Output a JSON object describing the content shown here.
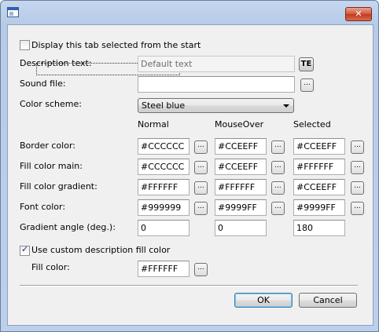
{
  "window": {
    "title": "",
    "close_label": "✕"
  },
  "display_tab_selected": {
    "label": "Display this tab selected from the start",
    "checked": false
  },
  "description": {
    "label": "Description text:",
    "placeholder": "Default text",
    "te_label": "TE"
  },
  "sound_file": {
    "label": "Sound file:",
    "value": "",
    "browse_label": "..."
  },
  "color_scheme": {
    "label": "Color scheme:",
    "selected": "Steel blue"
  },
  "columns": [
    "Normal",
    "MouseOver",
    "Selected"
  ],
  "browse_label": "...",
  "color_rows": [
    {
      "label": "Border color:",
      "values": [
        "#CCCCCC",
        "#CCEEFF",
        "#CCEEFF"
      ]
    },
    {
      "label": "Fill color main:",
      "values": [
        "#CCCCCC",
        "#CCEEFF",
        "#FFFFFF"
      ]
    },
    {
      "label": "Fill color gradient:",
      "values": [
        "#FFFFFF",
        "#FFFFFF",
        "#CCEEFF"
      ]
    },
    {
      "label": "Font color:",
      "values": [
        "#999999",
        "#9999FF",
        "#9999FF"
      ]
    }
  ],
  "gradient_angle": {
    "label": "Gradient angle (deg.):",
    "values": [
      "0",
      "0",
      "180"
    ]
  },
  "custom_fill": {
    "checkbox_label": "Use custom description fill color",
    "checked": true,
    "fill_label": "Fill color:",
    "fill_value": "#FFFFFF"
  },
  "buttons": {
    "ok": "OK",
    "cancel": "Cancel"
  }
}
